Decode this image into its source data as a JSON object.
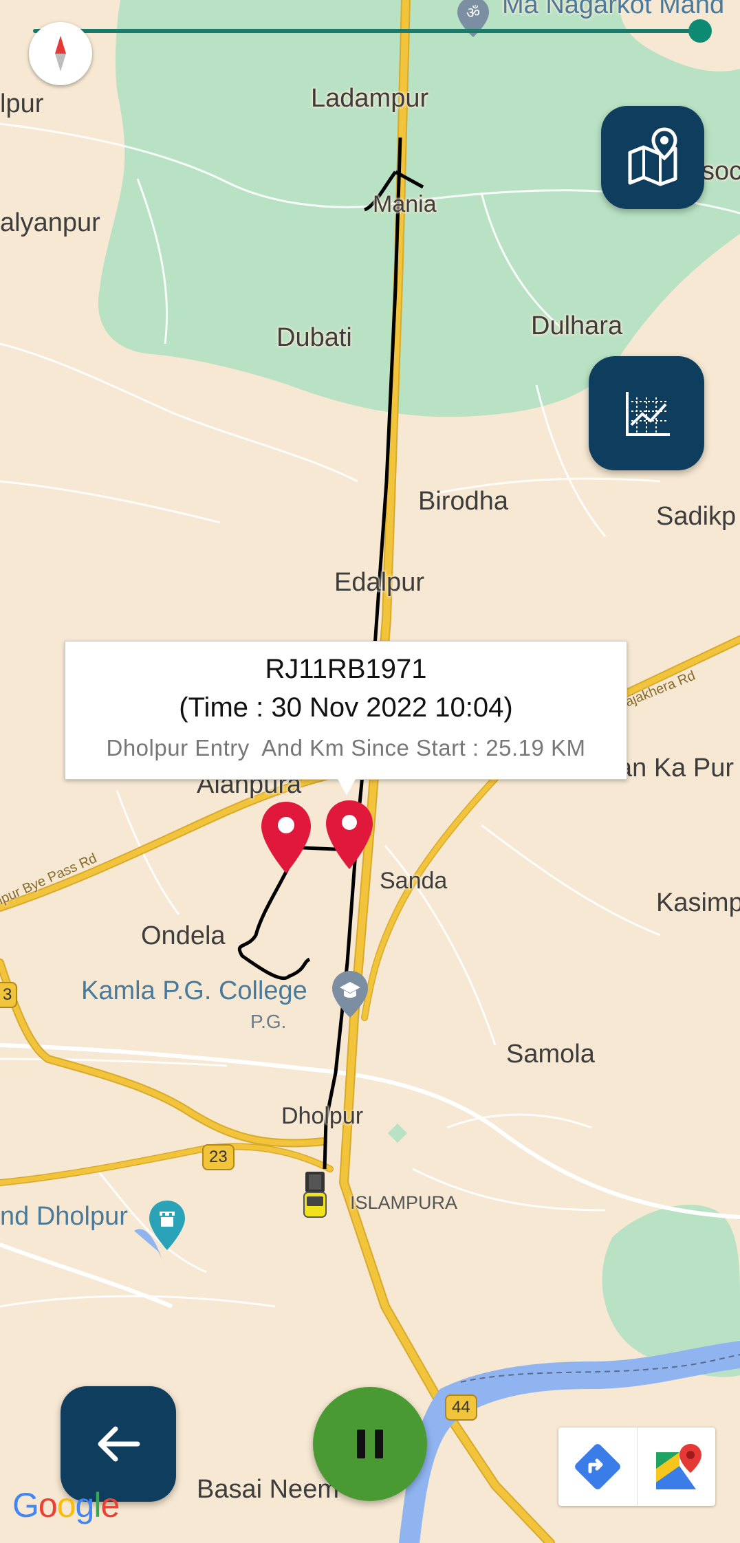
{
  "map": {
    "places": [
      {
        "name": "Ladampur",
        "cls": "lg"
      },
      {
        "name": "Mania",
        "cls": "md"
      },
      {
        "name": "alyanpur",
        "cls": "lg"
      },
      {
        "name": "lpur",
        "cls": "lg"
      },
      {
        "name": "Dubati",
        "cls": "lg"
      },
      {
        "name": "Dulhara",
        "cls": "lg"
      },
      {
        "name": "Birodha",
        "cls": "lg"
      },
      {
        "name": "Sadikp",
        "cls": "lg"
      },
      {
        "name": "Edalpur",
        "cls": "lg"
      },
      {
        "name": "Alanpura",
        "cls": "lg"
      },
      {
        "name": "an Ka Pur",
        "cls": "lg"
      },
      {
        "name": "Sanda",
        "cls": "md"
      },
      {
        "name": "Kasimp",
        "cls": "lg"
      },
      {
        "name": "Ondela",
        "cls": "lg"
      },
      {
        "name": "Samola",
        "cls": "lg"
      },
      {
        "name": "Dholpur",
        "cls": "md"
      },
      {
        "name": "ISLAMPURA",
        "cls": "sm"
      },
      {
        "name": "Basai Neem",
        "cls": "lg"
      },
      {
        "name": "soc",
        "cls": "lg"
      }
    ],
    "pois": {
      "temple_top": "Ma Nagarkot Mand",
      "college": "Kamla P.G. College",
      "college_sub": "P.G.",
      "fort": "nd Dholpur"
    },
    "roads": {
      "bypass": "lpur Bye Pass Rd",
      "rajakhera": "ajakhera Rd"
    },
    "shields": {
      "nh23": "23",
      "nh44": "44",
      "left_edge": "3"
    },
    "attribution": "Google",
    "colors": {
      "land": "#f6e8d2",
      "forest": "#b9e2c4",
      "highway": "#f2c43c",
      "river": "#8fb4f0",
      "route": "#000000",
      "marker": "#e0183c"
    }
  },
  "playback": {
    "progress": 0.99
  },
  "info_window": {
    "vehicle": "RJ11RB1971",
    "time": "(Time : 30 Nov 2022 10:04)",
    "description": "Dholpur Entry  And Km Since Start : 25.19 KM"
  },
  "buttons": {
    "compass": "compass-icon",
    "geofence": "map-pin-icon",
    "graph": "chart-icon",
    "back": "arrow-left-icon",
    "pause": "pause-icon",
    "directions": "directions-icon",
    "google_maps": "google-maps-icon"
  }
}
